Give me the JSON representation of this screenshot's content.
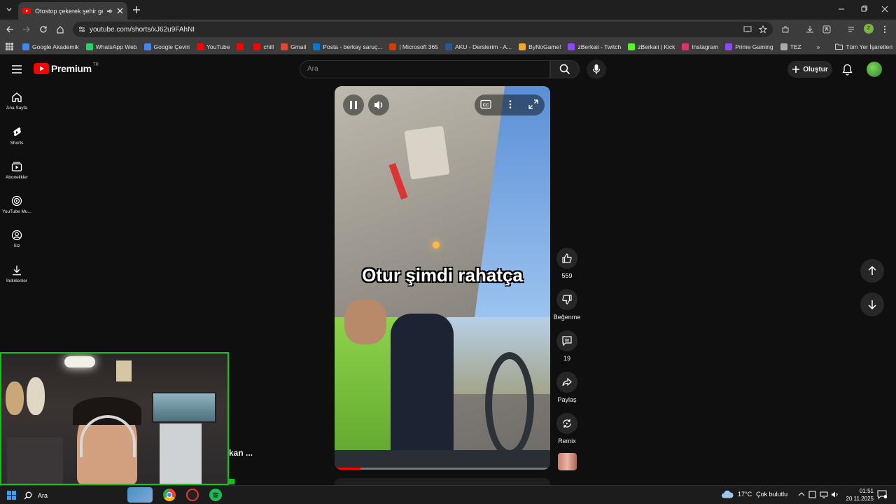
{
  "browser": {
    "tab_title": "Otostop çekerek şehir gehir",
    "url": "youtube.com/shorts/xJ62u9FAhNI",
    "bookmarks": [
      {
        "label": "Google Akademik",
        "color": "#4285f4"
      },
      {
        "label": "WhatsApp Web",
        "color": "#25d366"
      },
      {
        "label": "Google Çeviri",
        "color": "#4285f4"
      },
      {
        "label": "YouTube",
        "color": "#ff0000"
      },
      {
        "label": "",
        "color": "#ff0000"
      },
      {
        "label": "chill",
        "color": "#ff0000"
      },
      {
        "label": "Gmail",
        "color": "#ea4335"
      },
      {
        "label": "Posta - berkay saruç...",
        "color": "#0078d4"
      },
      {
        "label": "| Microsoft 365",
        "color": "#d83b01"
      },
      {
        "label": "AKU - Derslerim - A...",
        "color": "#2b5797"
      },
      {
        "label": "ByNoGame!",
        "color": "#f5a623"
      },
      {
        "label": "zBerkaii - Twitch",
        "color": "#9146ff"
      },
      {
        "label": "zBerkaii | Kick",
        "color": "#53fc18"
      },
      {
        "label": "Instagram",
        "color": "#e1306c"
      },
      {
        "label": "Prime Gaming",
        "color": "#9146ff"
      },
      {
        "label": "TEZ",
        "color": "#aaaaaa"
      }
    ],
    "all_bookmarks": "Tüm Yer İşaretleri",
    "profile_initial": "Z"
  },
  "youtube": {
    "logo_text": "Premium",
    "logo_region": "TR",
    "search_placeholder": "Ara",
    "create_label": "Oluştur",
    "sidebar": [
      {
        "label": "Ana Sayfa",
        "icon": "home-icon"
      },
      {
        "label": "Shorts",
        "icon": "shorts-icon"
      },
      {
        "label": "Abonelikler",
        "icon": "subscriptions-icon"
      },
      {
        "label": "YouTube Mu...",
        "icon": "music-icon"
      },
      {
        "label": "Siz",
        "icon": "you-icon"
      },
      {
        "label": "İndirilenler",
        "icon": "download-icon"
      }
    ],
    "video_caption": "Otur şimdi rahatça",
    "actions": {
      "like_count": "559",
      "dislike_label": "Beğenme",
      "comment_count": "19",
      "share_label": "Paylaş",
      "remix_label": "Remix"
    },
    "channel_partial": "kan ..."
  },
  "taskbar": {
    "search_label": "Ara",
    "weather": "17°C",
    "weather_desc": "Çok bulutlu",
    "time": "01:51",
    "date": "20.11.2025"
  }
}
